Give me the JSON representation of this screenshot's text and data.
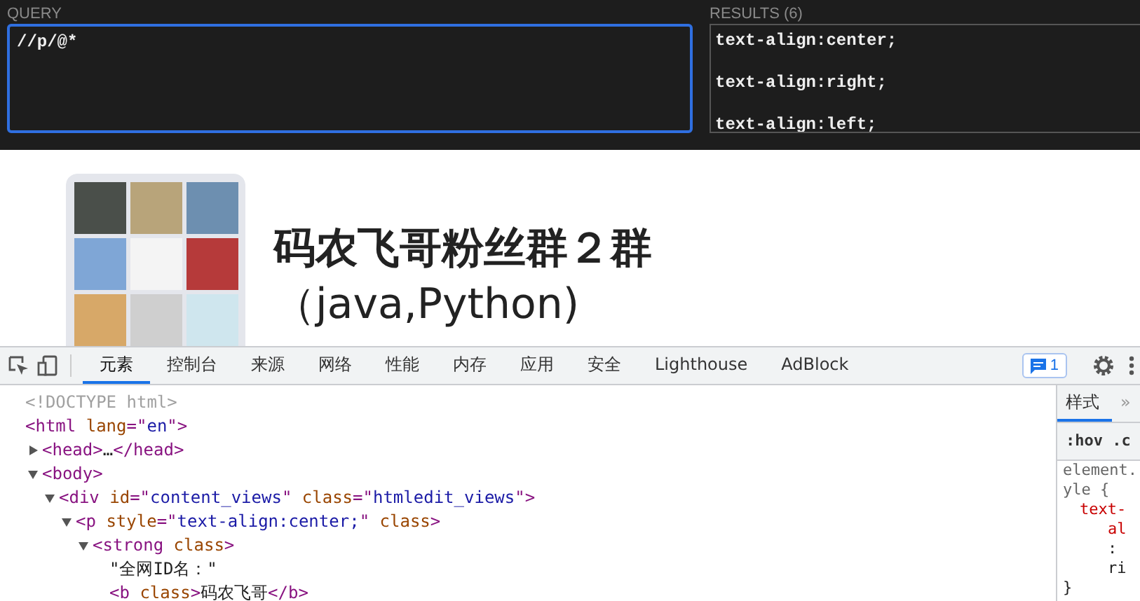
{
  "xpath_helper": {
    "query_label": "QUERY",
    "query_value": "//p/@*",
    "results_label": "RESULTS (6)",
    "results": [
      "text-align:center;",
      "text-align:right;",
      "text-align:left;"
    ]
  },
  "page": {
    "group_title": "码农飞哥粉丝群２群",
    "group_subtitle": "（java,Python)"
  },
  "devtools": {
    "tabs": [
      {
        "label": "元素",
        "selected": true
      },
      {
        "label": "控制台",
        "selected": false
      },
      {
        "label": "来源",
        "selected": false
      },
      {
        "label": "网络",
        "selected": false
      },
      {
        "label": "性能",
        "selected": false
      },
      {
        "label": "内存",
        "selected": false
      },
      {
        "label": "应用",
        "selected": false
      },
      {
        "label": "安全",
        "selected": false
      },
      {
        "label": "Lighthouse",
        "selected": false
      },
      {
        "label": "AdBlock",
        "selected": false
      }
    ],
    "message_count": "1",
    "dom_tree": [
      {
        "segments": [
          {
            "kind": "comment",
            "text": "<!DOCTYPE html>"
          }
        ]
      },
      {
        "segments": [
          {
            "kind": "tag",
            "text": "<html "
          },
          {
            "kind": "attr",
            "text": "lang"
          },
          {
            "kind": "tag",
            "text": "=\""
          },
          {
            "kind": "value",
            "text": "en"
          },
          {
            "kind": "tag",
            "text": "\">"
          }
        ],
        "children": [
          {
            "expanded": false,
            "segments": [
              {
                "kind": "tag",
                "text": "<head>"
              },
              {
                "kind": "text",
                "text": "…"
              },
              {
                "kind": "tag",
                "text": "</head>"
              }
            ]
          },
          {
            "expanded": true,
            "segments": [
              {
                "kind": "tag",
                "text": "<body>"
              }
            ],
            "children": [
              {
                "expanded": true,
                "segments": [
                  {
                    "kind": "tag",
                    "text": "<div "
                  },
                  {
                    "kind": "attr",
                    "text": "id"
                  },
                  {
                    "kind": "tag",
                    "text": "=\""
                  },
                  {
                    "kind": "value",
                    "text": "content_views"
                  },
                  {
                    "kind": "tag",
                    "text": "\" "
                  },
                  {
                    "kind": "attr",
                    "text": "class"
                  },
                  {
                    "kind": "tag",
                    "text": "=\""
                  },
                  {
                    "kind": "value",
                    "text": "htmledit_views"
                  },
                  {
                    "kind": "tag",
                    "text": "\">"
                  }
                ],
                "children": [
                  {
                    "expanded": true,
                    "segments": [
                      {
                        "kind": "tag",
                        "text": "<p "
                      },
                      {
                        "kind": "attr",
                        "text": "style"
                      },
                      {
                        "kind": "tag",
                        "text": "=\""
                      },
                      {
                        "kind": "value",
                        "text": "text-align:center;"
                      },
                      {
                        "kind": "tag",
                        "text": "\" "
                      },
                      {
                        "kind": "attr",
                        "text": "class"
                      },
                      {
                        "kind": "tag",
                        "text": ">"
                      }
                    ],
                    "children": [
                      {
                        "expanded": true,
                        "segments": [
                          {
                            "kind": "tag",
                            "text": "<strong "
                          },
                          {
                            "kind": "attr",
                            "text": "class"
                          },
                          {
                            "kind": "tag",
                            "text": ">"
                          }
                        ],
                        "children": [
                          {
                            "segments": [
                              {
                                "kind": "text",
                                "text": "\"全网ID名：\""
                              }
                            ]
                          },
                          {
                            "segments": [
                              {
                                "kind": "tag",
                                "text": "<b "
                              },
                              {
                                "kind": "attr",
                                "text": "class"
                              },
                              {
                                "kind": "tag",
                                "text": ">"
                              },
                              {
                                "kind": "text",
                                "text": "码农飞哥"
                              },
                              {
                                "kind": "tag",
                                "text": "</b>"
                              }
                            ]
                          }
                        ]
                      }
                    ]
                  }
                ]
              }
            ]
          }
        ]
      }
    ],
    "styles_pane": {
      "tabs": [
        {
          "label": "样式",
          "selected": true
        },
        {
          "label": "»",
          "selected": false
        }
      ],
      "filter": ":hov .c",
      "lines": [
        {
          "kind": "selector",
          "text": "element."
        },
        {
          "kind": "selector",
          "text": "yle {"
        },
        {
          "kind": "property",
          "text": "text-"
        },
        {
          "kind": "property_cont",
          "text": "al"
        },
        {
          "kind": "colon",
          "text": ":"
        },
        {
          "kind": "colon",
          "text": "ri"
        },
        {
          "kind": "brace",
          "text": "}"
        }
      ]
    }
  }
}
